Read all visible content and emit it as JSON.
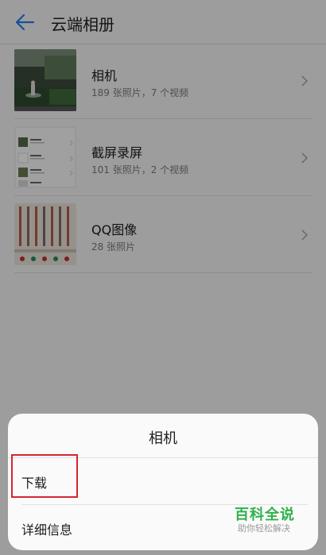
{
  "header": {
    "title": "云端相册"
  },
  "albums": [
    {
      "name": "相机",
      "count": "189 张照片，7 个视频"
    },
    {
      "name": "截屏录屏",
      "count": "101 张照片，2 个视频"
    },
    {
      "name": "QQ图像",
      "count": "28 张照片"
    }
  ],
  "sheet": {
    "title": "相机",
    "items": [
      "下载",
      "详细信息"
    ]
  },
  "watermark": {
    "main": "百科全说",
    "sub": "助你轻松解决"
  },
  "colors": {
    "accent": "#2b7cf0",
    "highlight": "#d6262d",
    "watermark": "#2fb14a"
  },
  "icons": [
    "back-arrow-icon",
    "chevron-right-icon"
  ]
}
